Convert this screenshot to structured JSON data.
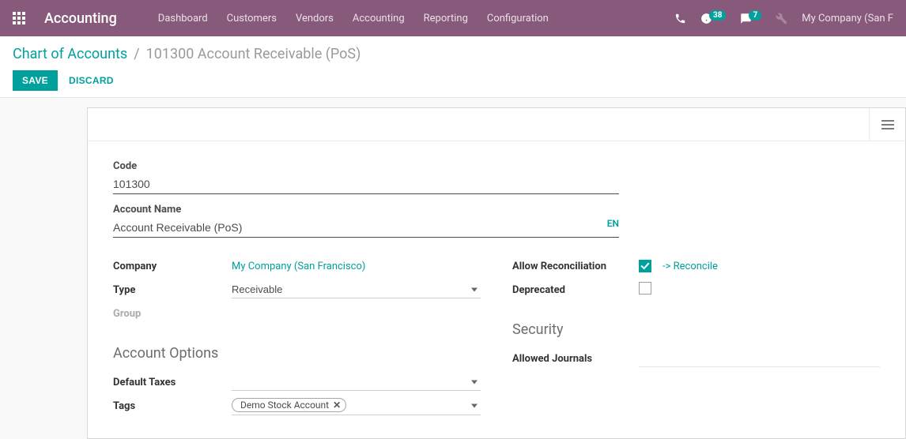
{
  "nav": {
    "brand": "Accounting",
    "items": [
      "Dashboard",
      "Customers",
      "Vendors",
      "Accounting",
      "Reporting",
      "Configuration"
    ],
    "activity_count": "38",
    "message_count": "7",
    "company": "My Company (San F"
  },
  "breadcrumb": {
    "parent": "Chart of Accounts",
    "sep": "/",
    "current": "101300 Account Receivable (PoS)"
  },
  "buttons": {
    "save": "SAVE",
    "discard": "DISCARD"
  },
  "form": {
    "code_label": "Code",
    "code_value": "101300",
    "name_label": "Account Name",
    "name_value": "Account Receivable (PoS)",
    "lang": "EN",
    "company_label": "Company",
    "company_value": "My Company (San Francisco)",
    "type_label": "Type",
    "type_value": "Receivable",
    "group_label": "Group",
    "allow_rec_label": "Allow Reconciliation",
    "reconcile_link": "-> Reconcile",
    "deprecated_label": "Deprecated",
    "section_options": "Account Options",
    "default_taxes_label": "Default Taxes",
    "tags_label": "Tags",
    "tags": [
      "Demo Stock Account"
    ],
    "section_security": "Security",
    "allowed_journals_label": "Allowed Journals"
  }
}
